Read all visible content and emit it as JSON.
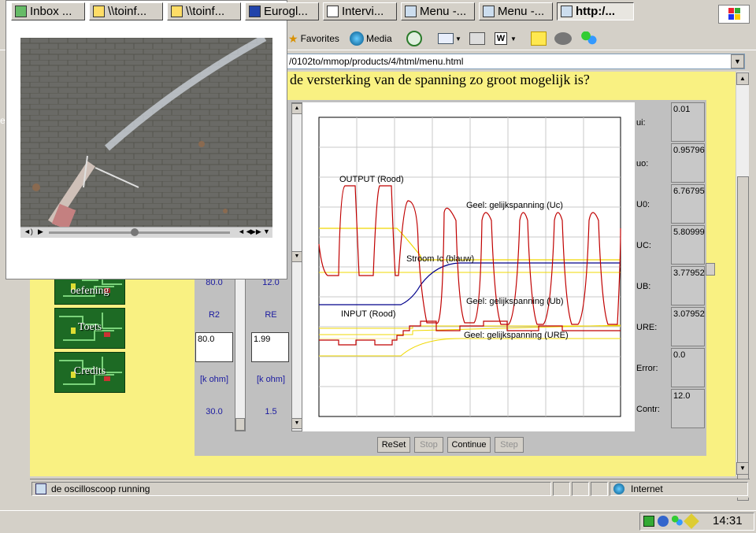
{
  "toolbar": {
    "favorites_label": "Favorites",
    "media_label": "Media"
  },
  "address": {
    "url": "/0102to/mmop/products/4/html/menu.html"
  },
  "page": {
    "question": "de versterking van de spanning zo groot mogelijk is?",
    "left_edge_char": "e"
  },
  "menu": {
    "items": [
      {
        "label": "oefening"
      },
      {
        "label": "Toets"
      },
      {
        "label": "Credits"
      }
    ]
  },
  "controls": {
    "col1_top": "80.0",
    "col2_top": "12.0",
    "col1_name": "R2",
    "col2_name": "RE",
    "col1_value": "80.0",
    "col2_value": "1.99",
    "col1_unit": "[k ohm]",
    "col2_unit": "[k ohm]",
    "col1_min": "30.0",
    "col2_min": "1.5"
  },
  "scope": {
    "labels": {
      "output": "OUTPUT (Rood)",
      "uc": "Geel: gelijkspanning (Uc)",
      "ic": "Stroom Ic (blauw)",
      "ub": "Geel: gelijkspanning (Ub)",
      "input": "INPUT (Rood)",
      "ure": "Geel: gelijkspanning (URE)"
    },
    "colors": {
      "red": "#c00000",
      "yellow": "#f0d800",
      "blue": "#00008b",
      "grid": "#c8c8c8"
    }
  },
  "readouts": [
    {
      "label": "ui:",
      "value": "0.01"
    },
    {
      "label": "uo:",
      "value": "0.95796"
    },
    {
      "label": "U0:",
      "value": "6.76795"
    },
    {
      "label": "UC:",
      "value": "5.80999"
    },
    {
      "label": "UB:",
      "value": "3.77952"
    },
    {
      "label": "URE:",
      "value": "3.07952"
    },
    {
      "label": "Error:",
      "value": "0.0"
    },
    {
      "label": "Contr:",
      "value": "12.0"
    }
  ],
  "buttons": {
    "reset": "ReSet",
    "stop": "Stop",
    "continue": "Continue",
    "step": "Step"
  },
  "status": {
    "text": "de oscilloscoop running",
    "zone": "Internet"
  },
  "taskbar": {
    "tasks": [
      {
        "label": "Inbox ..."
      },
      {
        "label": "\\\\toinf..."
      },
      {
        "label": "\\\\toinf..."
      },
      {
        "label": "Eurogl..."
      },
      {
        "label": "Intervi..."
      },
      {
        "label": "Menu -..."
      },
      {
        "label": "Menu -..."
      },
      {
        "label": "http:/..."
      }
    ],
    "clock": "14:31"
  }
}
